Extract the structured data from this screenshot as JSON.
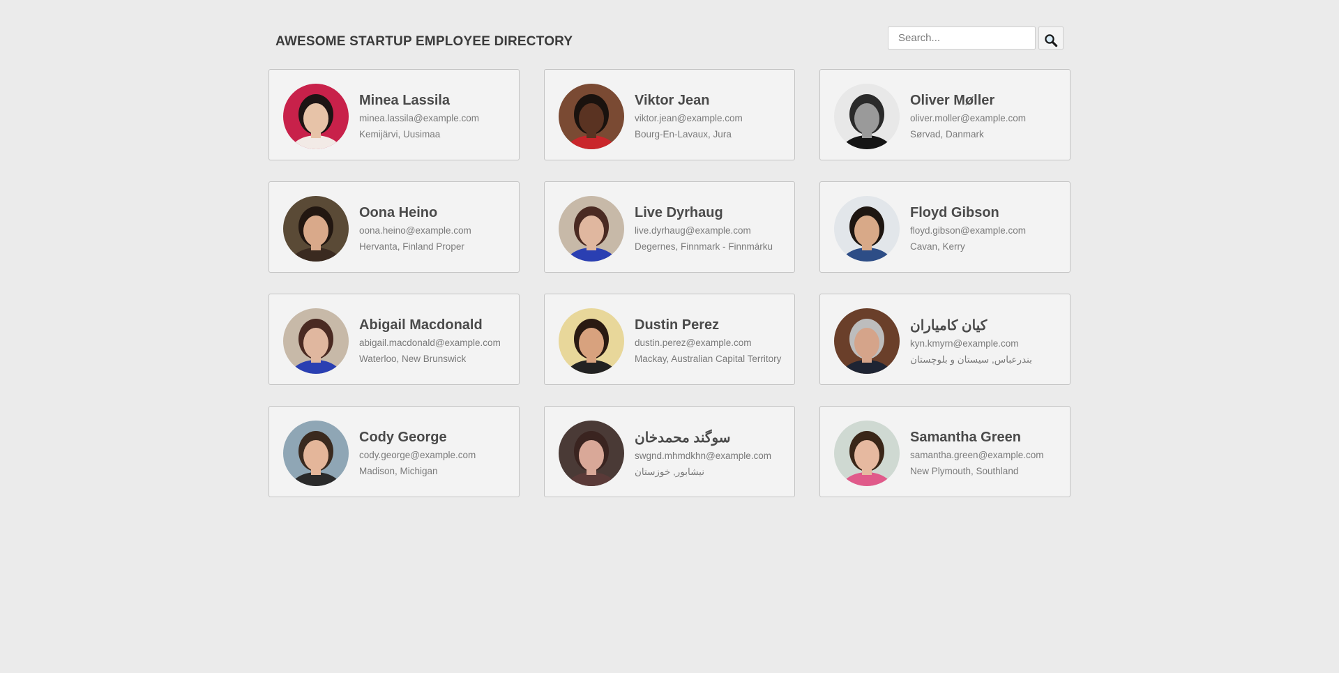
{
  "header": {
    "title": "AWESOME STARTUP EMPLOYEE DIRECTORY",
    "search_placeholder": "Search...",
    "search_button_icon": "magnifying-glass-icon"
  },
  "employees": [
    {
      "name": "Minea Lassila",
      "email": "minea.lassila@example.com",
      "location": "Kemijärvi, Uusimaa",
      "avatar": {
        "bg": "#c8214a",
        "skin": "#e7c3a8",
        "hair": "#1d1414",
        "shirt": "#f2eae6"
      }
    },
    {
      "name": "Viktor Jean",
      "email": "viktor.jean@example.com",
      "location": "Bourg-En-Lavaux, Jura",
      "avatar": {
        "bg": "#7a4a33",
        "skin": "#5a3322",
        "hair": "#1a120e",
        "shirt": "#c9262b"
      }
    },
    {
      "name": "Oliver Møller",
      "email": "oliver.moller@example.com",
      "location": "Sørvad, Danmark",
      "avatar": {
        "bg": "#e8e8e8",
        "skin": "#9a9a9a",
        "hair": "#2a2a2a",
        "shirt": "#151515"
      }
    },
    {
      "name": "Oona Heino",
      "email": "oona.heino@example.com",
      "location": "Hervanta, Finland Proper",
      "avatar": {
        "bg": "#5a4a36",
        "skin": "#d9a98a",
        "hair": "#221711",
        "shirt": "#3a2a20"
      }
    },
    {
      "name": "Live Dyrhaug",
      "email": "live.dyrhaug@example.com",
      "location": "Degernes, Finnmark - Finnmárku",
      "avatar": {
        "bg": "#c7b9a8",
        "skin": "#e0b79f",
        "hair": "#4a2a22",
        "shirt": "#2a3fb2"
      }
    },
    {
      "name": "Floyd Gibson",
      "email": "floyd.gibson@example.com",
      "location": "Cavan, Kerry",
      "avatar": {
        "bg": "#e2e6ea",
        "skin": "#d8a988",
        "hair": "#1e1611",
        "shirt": "#2d4d86"
      }
    },
    {
      "name": "Abigail Macdonald",
      "email": "abigail.macdonald@example.com",
      "location": "Waterloo, New Brunswick",
      "avatar": {
        "bg": "#c7b9a8",
        "skin": "#e0b79f",
        "hair": "#4a2a22",
        "shirt": "#2a3fb2"
      }
    },
    {
      "name": "Dustin Perez",
      "email": "dustin.perez@example.com",
      "location": "Mackay, Australian Capital Territory",
      "avatar": {
        "bg": "#e8d79a",
        "skin": "#d8a27e",
        "hair": "#2a1a12",
        "shirt": "#222222"
      }
    },
    {
      "name": "کیان کامیاران",
      "email": "kyn.kmyrn@example.com",
      "location": "بندرعباس, سیستان و بلوچستان",
      "avatar": {
        "bg": "#6a3f2a",
        "skin": "#d5a48a",
        "hair": "#bdbdbd",
        "shirt": "#1e2433"
      }
    },
    {
      "name": "Cody George",
      "email": "cody.george@example.com",
      "location": "Madison, Michigan",
      "avatar": {
        "bg": "#8fa6b5",
        "skin": "#e4b69a",
        "hair": "#3a2a1f",
        "shirt": "#2a2a2a"
      }
    },
    {
      "name": "سوگند محمدخان",
      "email": "swgnd.mhmdkhn@example.com",
      "location": "نیشابور, خوزستان",
      "avatar": {
        "bg": "#4a3a36",
        "skin": "#d9a898",
        "hair": "#3a2420",
        "shirt": "#5a3a38"
      }
    },
    {
      "name": "Samantha Green",
      "email": "samantha.green@example.com",
      "location": "New Plymouth, Southland",
      "avatar": {
        "bg": "#cfd9d2",
        "skin": "#e6b9a0",
        "hair": "#3a2618",
        "shirt": "#e05a8a"
      }
    }
  ]
}
